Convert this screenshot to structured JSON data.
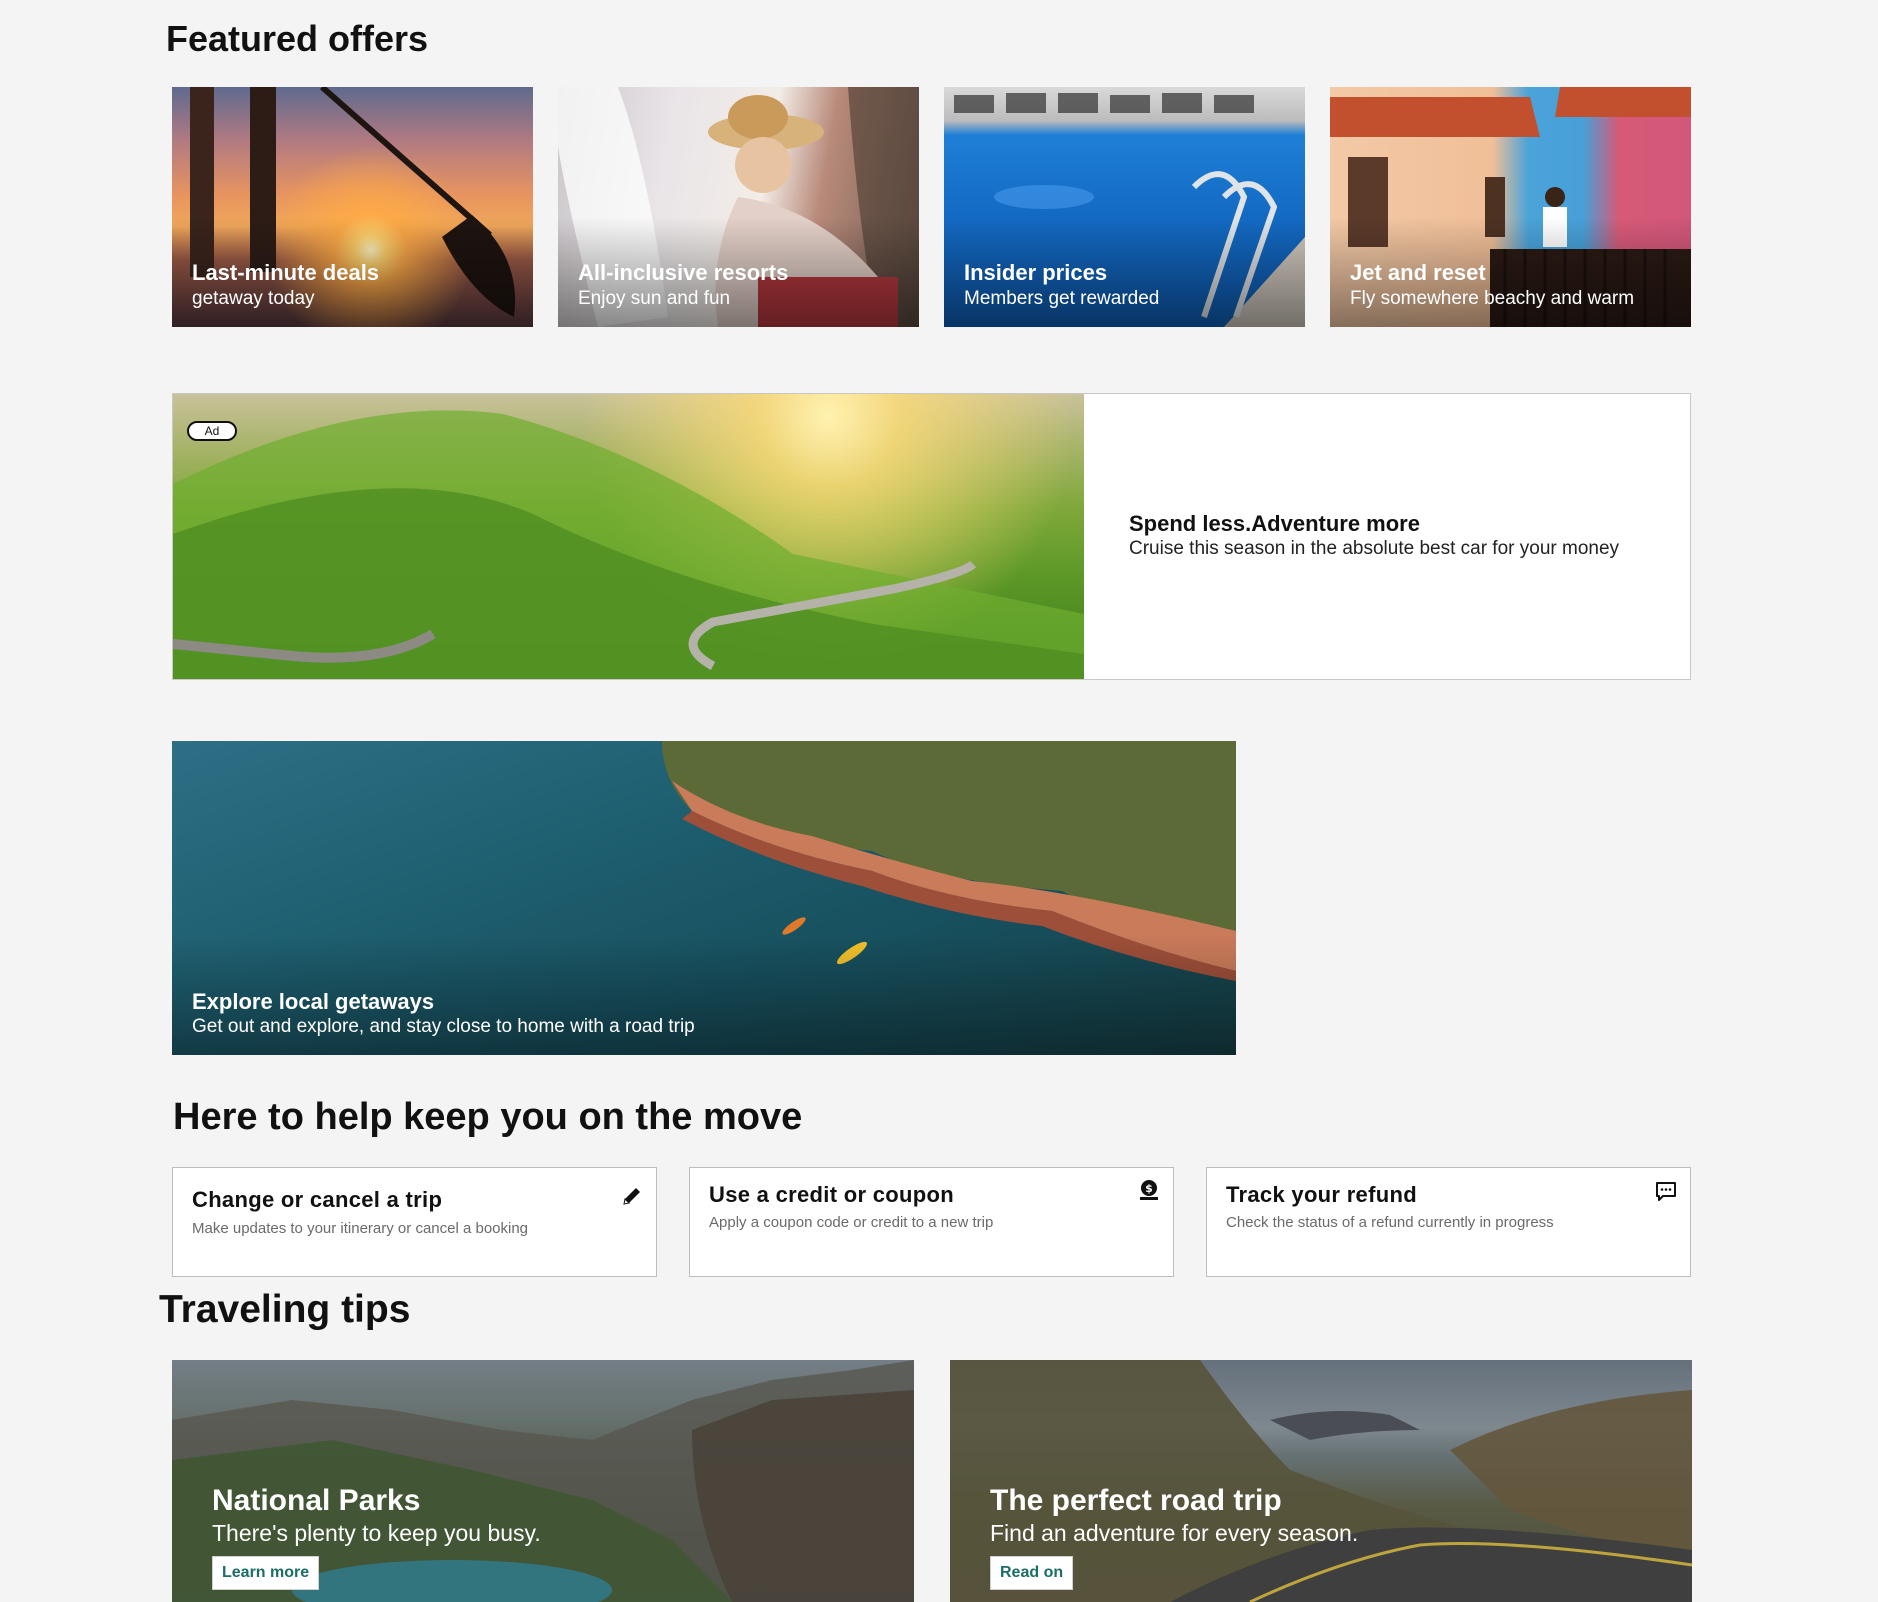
{
  "featured": {
    "title": "Featured offers",
    "cards": [
      {
        "title": "Last-minute deals",
        "subtitle": "getaway today"
      },
      {
        "title": "All-inclusive resorts",
        "subtitle": "Enjoy sun and fun"
      },
      {
        "title": "Insider prices",
        "subtitle": "Members get rewarded"
      },
      {
        "title": "Jet and reset",
        "subtitle": "Fly somewhere beachy and warm"
      }
    ]
  },
  "ad": {
    "badge": "Ad",
    "title": "Spend less.Adventure more",
    "subtitle": "Cruise this season in the absolute best car for your money"
  },
  "explore": {
    "title": "Explore local getaways",
    "subtitle": "Get out and explore, and stay close to home with a road trip"
  },
  "help": {
    "title": "Here to help keep you on the move",
    "cards": [
      {
        "title": "Change or cancel a trip",
        "subtitle": "Make updates to your itinerary or cancel a booking",
        "icon": "pencil-icon"
      },
      {
        "title": "Use a credit or coupon",
        "subtitle": "Apply a coupon code or credit to a new trip",
        "icon": "coupon-dollar-icon"
      },
      {
        "title": "Track your refund",
        "subtitle": "Check the status of a refund currently in progress",
        "icon": "chat-bubble-icon"
      }
    ]
  },
  "tips": {
    "title": "Traveling tips",
    "cards": [
      {
        "title": "National Parks",
        "subtitle": "There's plenty to keep you busy.",
        "button": "Learn more"
      },
      {
        "title": "The perfect road trip",
        "subtitle": "Find an adventure for every season.",
        "button": "Read on"
      }
    ]
  },
  "colors": {
    "page_background": "#f4f4f4",
    "link_button_text": "#1b6e64"
  }
}
